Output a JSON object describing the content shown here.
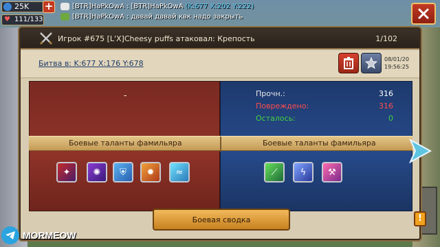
{
  "hud": {
    "power": "25K",
    "hp": "111/133"
  },
  "chat": [
    {
      "sender": "[BTR]HaPkOwA",
      "sep": ":",
      "text": "[BTR]HaPkOwA",
      "coords": "(K:677 X:202 Y:222)"
    },
    {
      "sender": "[BTR]HaPkOwA",
      "sep": ":",
      "text": "давай давай квк надо закрыть"
    }
  ],
  "report": {
    "title": "Игрок #675 [L'X]Cheesy puffs атаковал: Крепость",
    "page": "1/102",
    "battle_link": "Битва в: K:677 X:176 Y:678",
    "date": "08/01/20",
    "time": "19:56:25"
  },
  "left": {
    "placeholder": "-",
    "talents_title": "Боевые таланты фамильяра"
  },
  "right": {
    "talents_title": "Боевые таланты фамильяра",
    "stats": [
      {
        "label": "Прочн.:",
        "value": "316"
      },
      {
        "label": "Повреждено:",
        "value": "316"
      },
      {
        "label": "Осталось:",
        "value": "0"
      }
    ]
  },
  "summary_button": "Боевая сводка",
  "watermark": "MORMEOW",
  "alert_badge": "!",
  "colors": {
    "attacker_panel": "#8f3328",
    "defender_panel": "#264a8a",
    "damaged": "#ff4d4d",
    "remaining": "#43d043",
    "link": "#54c8f0"
  }
}
